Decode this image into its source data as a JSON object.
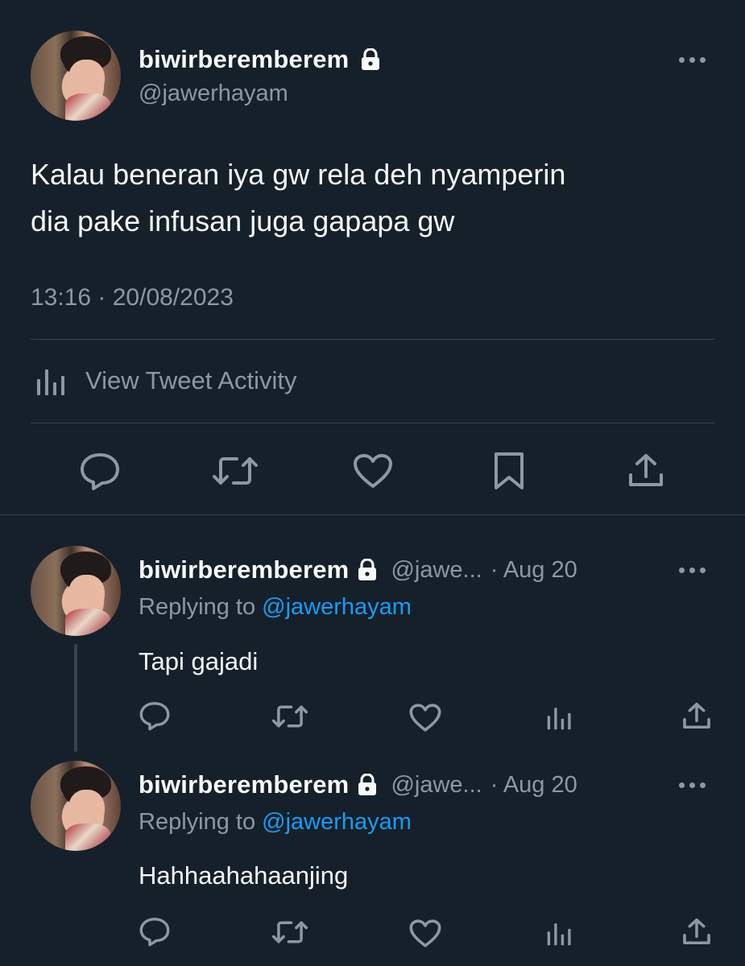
{
  "main_tweet": {
    "display_name": "biwirberemberem",
    "handle": "@jawerhayam",
    "text_line1": "Kalau beneran iya gw rela deh nyamperin",
    "text_line2": "dia pake infusan juga gapapa gw",
    "timestamp": "13:16 · 20/08/2023",
    "activity_label": "View Tweet Activity"
  },
  "replies": [
    {
      "display_name": "biwirberemberem",
      "handle_truncated": "@jawe...",
      "date": "· Aug 20",
      "replying_prefix": "Replying to",
      "replying_to": "@jawerhayam",
      "text": "Tapi gajadi"
    },
    {
      "display_name": "biwirberemberem",
      "handle_truncated": "@jawe...",
      "date": "· Aug 20",
      "replying_prefix": "Replying to",
      "replying_to": "@jawerhayam",
      "text": "Hahhaahahaanjing"
    }
  ],
  "colors": {
    "background": "#15202b",
    "text_primary": "#f7f9f9",
    "text_muted": "#8b98a5",
    "link": "#1d9bf0",
    "divider": "#38444d"
  },
  "icons": [
    "lock-icon",
    "more-icon",
    "analytics-icon",
    "reply-icon",
    "retweet-icon",
    "like-icon",
    "bookmark-icon",
    "share-icon"
  ]
}
